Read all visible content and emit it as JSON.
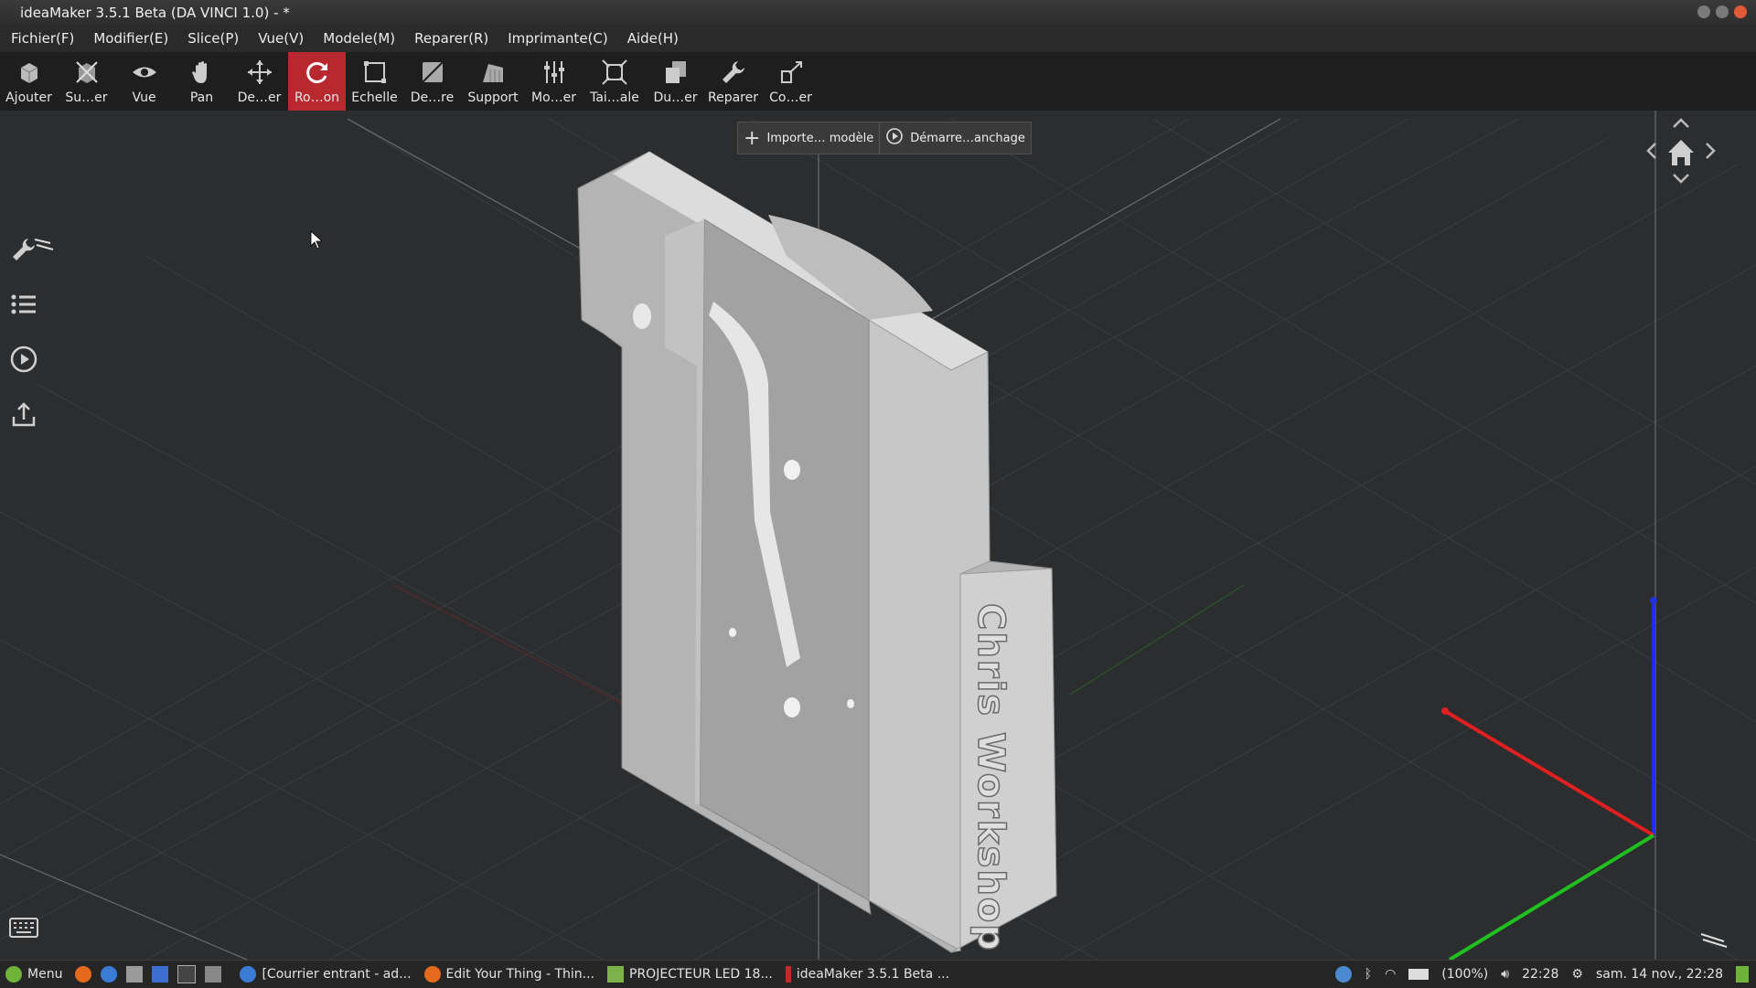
{
  "window": {
    "title": "ideaMaker 3.5.1 Beta (DA VINCI 1.0) - *"
  },
  "menubar": {
    "items": [
      "Fichier(F)",
      "Modifier(E)",
      "Slice(P)",
      "Vue(V)",
      "Modele(M)",
      "Reparer(R)",
      "Imprimante(C)",
      "Aide(H)"
    ]
  },
  "toolbar": {
    "tools": [
      {
        "label": "Ajouter",
        "icon": "add-model-icon"
      },
      {
        "label": "Su…er",
        "icon": "remove-model-icon"
      },
      {
        "label": "Vue",
        "icon": "eye-icon"
      },
      {
        "label": "Pan",
        "icon": "hand-icon"
      },
      {
        "label": "De…er",
        "icon": "move-icon"
      },
      {
        "label": "Ro…on",
        "icon": "rotate-icon",
        "active": true
      },
      {
        "label": "Echelle",
        "icon": "scale-icon"
      },
      {
        "label": "De…re",
        "icon": "cut-icon"
      },
      {
        "label": "Support",
        "icon": "support-icon"
      },
      {
        "label": "Mo…er",
        "icon": "modify-sliders-icon"
      },
      {
        "label": "Tai…ale",
        "icon": "original-size-icon"
      },
      {
        "label": "Du…er",
        "icon": "duplicate-icon"
      },
      {
        "label": "Reparer",
        "icon": "wrench-icon"
      },
      {
        "label": "Co…er",
        "icon": "connect-icon"
      }
    ]
  },
  "banner": {
    "import_label": "Importe… modèle",
    "start_label": "Démarre…anchage"
  },
  "model": {
    "engraving": "Chris Workshop"
  },
  "sidebar": {
    "icons": [
      "wrench-icon",
      "list-icon",
      "play-icon",
      "upload-icon"
    ]
  },
  "taskbar": {
    "menu_label": "Menu",
    "windows": [
      {
        "label": "[Courrier entrant - ad...",
        "icon": "thunderbird-icon"
      },
      {
        "label": "Edit Your Thing - Thin...",
        "icon": "firefox-icon"
      },
      {
        "label": "PROJECTEUR LED 18...",
        "icon": "folder-icon"
      },
      {
        "label": "ideaMaker 3.5.1 Beta ...",
        "icon": "ideamaker-icon"
      }
    ],
    "battery": "(100%)",
    "time": "22:28",
    "datetime": "sam. 14 nov., 22:28"
  },
  "colors": {
    "active_tool": "#b8282f",
    "axis_x": "#e02020",
    "axis_y": "#20c020",
    "axis_z": "#2030e0",
    "grid": "#3c3f42",
    "model": "#c8c8c8"
  }
}
